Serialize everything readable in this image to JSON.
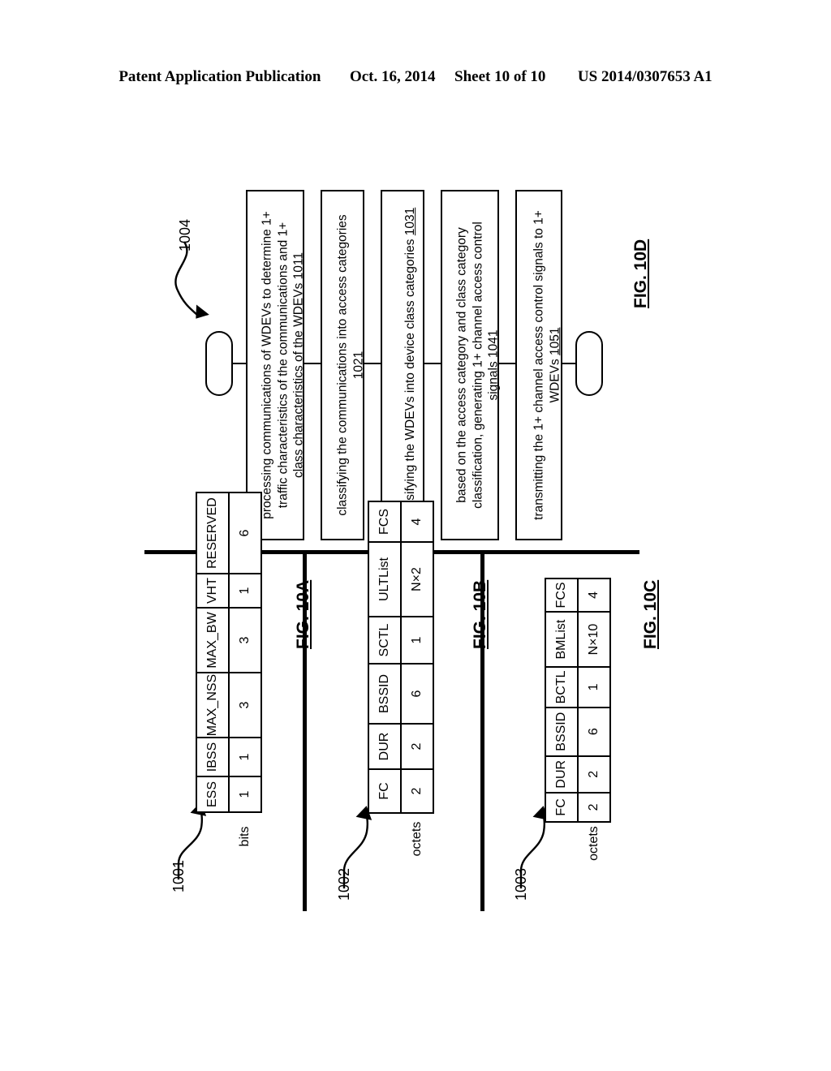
{
  "header": {
    "publication": "Patent Application Publication",
    "date": "Oct. 16, 2014",
    "sheet": "Sheet 10 of 10",
    "docnum": "US 2014/0307653 A1"
  },
  "figures": {
    "fig10a": {
      "label": "FIG. 10A",
      "ref": "1001",
      "row_label": "bits",
      "columns": [
        "ESS",
        "IBSS",
        "MAX_NSS",
        "MAX_BW",
        "VHT",
        "RESERVED"
      ],
      "values": [
        "1",
        "1",
        "3",
        "3",
        "1",
        "6"
      ]
    },
    "fig10b": {
      "label": "FIG. 10B",
      "ref": "1002",
      "row_label": "octets",
      "columns": [
        "FC",
        "DUR",
        "BSSID",
        "SCTL",
        "ULTList",
        "FCS"
      ],
      "values": [
        "2",
        "2",
        "6",
        "1",
        "N×2",
        "4"
      ]
    },
    "fig10c": {
      "label": "FIG. 10C",
      "ref": "1003",
      "row_label": "octets",
      "columns": [
        "FC",
        "DUR",
        "BSSID",
        "BCTL",
        "BMList",
        "FCS"
      ],
      "values": [
        "2",
        "2",
        "6",
        "1",
        "N×10",
        "4"
      ]
    },
    "fig10d": {
      "label": "FIG. 10D",
      "ref": "1004",
      "steps": [
        {
          "text": "processing communications of WDEVs to determine 1+\ntraffic characteristics of the communications and 1+\nclass characteristics of the WDEVs ",
          "num": "1011"
        },
        {
          "text": "classifying the communications into access categories\n",
          "num": "1021"
        },
        {
          "text": "classifying the WDEVs into device class categories ",
          "num": "1031"
        },
        {
          "text": "based on the access category and class category\nclassification, generating 1+ channel access control\nsignals ",
          "num": "1041"
        },
        {
          "text": "transmitting the 1+ channel access control signals to 1+\nWDEVs ",
          "num": "1051"
        }
      ]
    }
  }
}
